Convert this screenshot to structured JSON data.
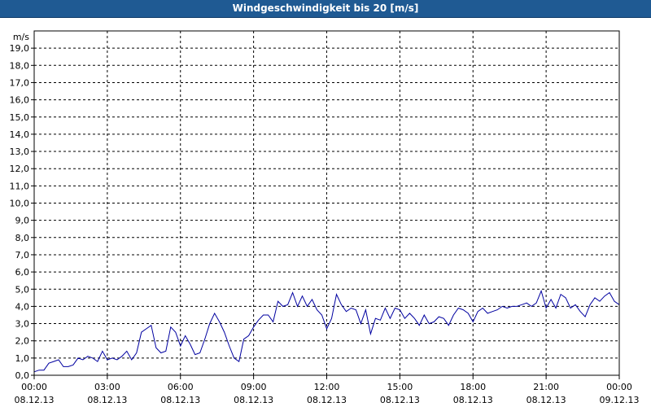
{
  "title": "Windgeschwindigkeit bis 20 [m/s]",
  "chart_data": {
    "type": "line",
    "title": "Windgeschwindigkeit bis 20 [m/s]",
    "ylabel": "m/s",
    "ylim": [
      0,
      20
    ],
    "xlim": [
      0,
      24
    ],
    "y_ticks": [
      "0,0",
      "1,0",
      "2,0",
      "3,0",
      "4,0",
      "5,0",
      "6,0",
      "7,0",
      "8,0",
      "9,0",
      "10,0",
      "11,0",
      "12,0",
      "13,0",
      "14,0",
      "15,0",
      "16,0",
      "17,0",
      "18,0",
      "19,0"
    ],
    "x_ticks": [
      {
        "time": "00:00",
        "date": "08.12.13"
      },
      {
        "time": "03:00",
        "date": "08.12.13"
      },
      {
        "time": "06:00",
        "date": "08.12.13"
      },
      {
        "time": "09:00",
        "date": "08.12.13"
      },
      {
        "time": "12:00",
        "date": "08.12.13"
      },
      {
        "time": "15:00",
        "date": "08.12.13"
      },
      {
        "time": "18:00",
        "date": "08.12.13"
      },
      {
        "time": "21:00",
        "date": "08.12.13"
      },
      {
        "time": "00:00",
        "date": "09.12.13"
      }
    ],
    "grid": true,
    "line_color": "#0000a0",
    "series": [
      {
        "x": [
          0.0,
          0.2,
          0.4,
          0.6,
          0.8,
          1.0,
          1.2,
          1.4,
          1.6,
          1.8,
          2.0,
          2.2,
          2.4,
          2.6,
          2.8,
          3.0,
          3.2,
          3.4,
          3.6,
          3.8,
          4.0,
          4.2,
          4.4,
          4.6,
          4.8,
          5.0,
          5.2,
          5.4,
          5.6,
          5.8,
          6.0,
          6.2,
          6.4,
          6.6,
          6.8,
          7.0,
          7.2,
          7.4,
          7.6,
          7.8,
          8.0,
          8.2,
          8.4,
          8.6,
          8.8,
          9.0,
          9.2,
          9.4,
          9.6,
          9.8,
          10.0,
          10.2,
          10.4,
          10.6,
          10.8,
          11.0,
          11.2,
          11.4,
          11.6,
          11.8,
          12.0,
          12.2,
          12.4,
          12.6,
          12.8,
          13.0,
          13.2,
          13.4,
          13.6,
          13.8,
          14.0,
          14.2,
          14.4,
          14.6,
          14.8,
          15.0,
          15.2,
          15.4,
          15.6,
          15.8,
          16.0,
          16.2,
          16.4,
          16.6,
          16.8,
          17.0,
          17.2,
          17.4,
          17.6,
          17.8,
          18.0,
          18.2,
          18.4,
          18.6,
          18.8,
          19.0,
          19.2,
          19.4,
          19.6,
          19.8,
          20.0,
          20.2,
          20.4,
          20.6,
          20.8,
          21.0,
          21.2,
          21.4,
          21.6,
          21.8,
          22.0,
          22.2,
          22.4,
          22.6,
          22.8,
          23.0,
          23.2,
          23.4,
          23.6,
          23.8,
          24.0
        ],
        "values": [
          0.2,
          0.3,
          0.3,
          0.7,
          0.8,
          0.9,
          0.5,
          0.5,
          0.6,
          1.0,
          0.9,
          1.1,
          1.0,
          0.8,
          1.4,
          0.9,
          1.0,
          0.9,
          1.1,
          1.4,
          0.9,
          1.3,
          2.5,
          2.7,
          2.9,
          1.6,
          1.3,
          1.4,
          2.8,
          2.5,
          1.7,
          2.3,
          1.8,
          1.2,
          1.3,
          2.1,
          3.0,
          3.6,
          3.1,
          2.5,
          1.7,
          1.0,
          0.8,
          2.1,
          2.3,
          2.8,
          3.2,
          3.5,
          3.5,
          3.1,
          4.3,
          4.0,
          4.1,
          4.8,
          4.0,
          4.6,
          4.0,
          4.4,
          3.8,
          3.5,
          2.7,
          3.3,
          4.7,
          4.1,
          3.7,
          3.9,
          3.8,
          3.0,
          3.8,
          2.4,
          3.3,
          3.2,
          3.9,
          3.3,
          3.9,
          3.8,
          3.3,
          3.6,
          3.3,
          2.9,
          3.5,
          3.0,
          3.1,
          3.4,
          3.3,
          2.9,
          3.5,
          3.9,
          3.8,
          3.6,
          3.1,
          3.7,
          3.9,
          3.6,
          3.7,
          3.8,
          4.0,
          3.9,
          4.0,
          4.0,
          4.1,
          4.2,
          4.0,
          4.2,
          4.9,
          3.9,
          4.4,
          3.9,
          4.7,
          4.5,
          3.9,
          4.1,
          3.7,
          3.4,
          4.1,
          4.5,
          4.3,
          4.6,
          4.8,
          4.3,
          4.1
        ]
      }
    ]
  }
}
